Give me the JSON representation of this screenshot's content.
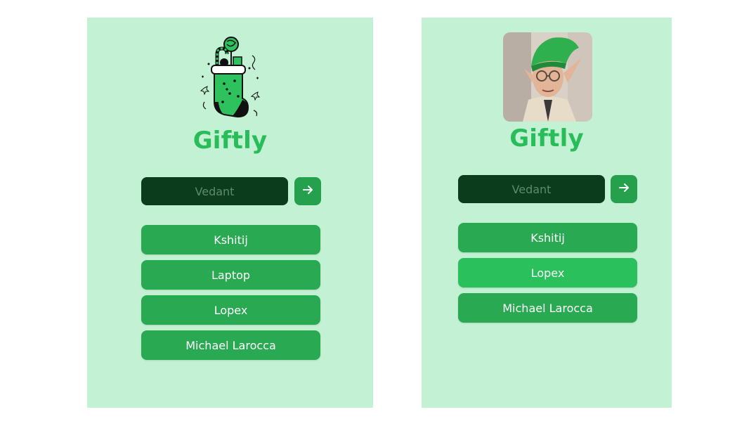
{
  "colors": {
    "panel_bg": "#c3f1d3",
    "brand_green": "#29bd5a",
    "input_bg": "#0b3d1c",
    "button_green": "#29a952",
    "button_highlight": "#2ac05b"
  },
  "left_panel": {
    "hero_icon": "christmas-stocking-icon",
    "brand": "Giftly",
    "input_placeholder": "Vedant",
    "submit_icon": "arrow-right-icon",
    "items": [
      {
        "label": "Kshitij"
      },
      {
        "label": "Laptop"
      },
      {
        "label": "Lopex"
      },
      {
        "label": "Michael Larocca"
      }
    ]
  },
  "right_panel": {
    "hero_image": "elf-photo",
    "brand": "Giftly",
    "input_placeholder": "Vedant",
    "submit_icon": "arrow-right-icon",
    "items": [
      {
        "label": "Kshitij",
        "highlighted": false
      },
      {
        "label": "Lopex",
        "highlighted": true
      },
      {
        "label": "Michael Larocca",
        "highlighted": false
      }
    ]
  }
}
